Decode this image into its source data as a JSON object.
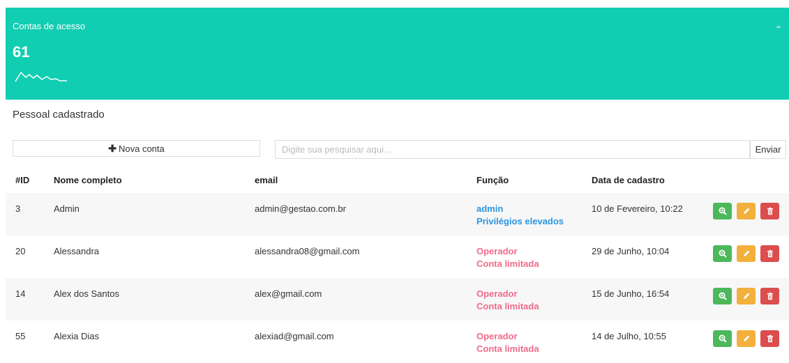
{
  "summary": {
    "title": "Contas de acesso",
    "count": "61",
    "spark_icon": "sparkline-icon",
    "accent_color": "#11cdb1"
  },
  "section_title": "Pessoal cadastrado",
  "toolbar": {
    "new_account_label": "Nova conta",
    "search_placeholder": "Digite sua pesquisar aqui...",
    "send_label": "Enviar"
  },
  "table": {
    "headers": {
      "id": "#ID",
      "name": "Nome completo",
      "email": "email",
      "role": "Função",
      "date": "Data de cadastro"
    },
    "rows": [
      {
        "id": "3",
        "name": "Admin",
        "email": "admin@gestao.com.br",
        "role": "admin",
        "role_detail": "Privilégios elevados",
        "role_type": "admin",
        "date": "10 de Fevereiro, 10:22"
      },
      {
        "id": "20",
        "name": "Alessandra",
        "email": "alessandra08@gmail.com",
        "role": "Operador",
        "role_detail": "Conta limitada",
        "role_type": "op",
        "date": "29 de Junho, 10:04"
      },
      {
        "id": "14",
        "name": "Alex dos Santos",
        "email": "alex@gmail.com",
        "role": "Operador",
        "role_detail": "Conta limitada",
        "role_type": "op",
        "date": "15 de Junho, 16:54"
      },
      {
        "id": "55",
        "name": "Alexia Dias",
        "email": "alexiad@gmail.com",
        "role": "Operador",
        "role_detail": "Conta limitada",
        "role_type": "op",
        "date": "14 de Julho, 10:55"
      }
    ],
    "action_icons": [
      "zoom-in-icon",
      "pencil-icon",
      "trash-icon"
    ],
    "colors": {
      "view": "#4cb85b",
      "edit": "#f2b03d",
      "delete": "#dc4d4d",
      "admin": "#2b95e4",
      "operator": "#f06a8a"
    }
  }
}
